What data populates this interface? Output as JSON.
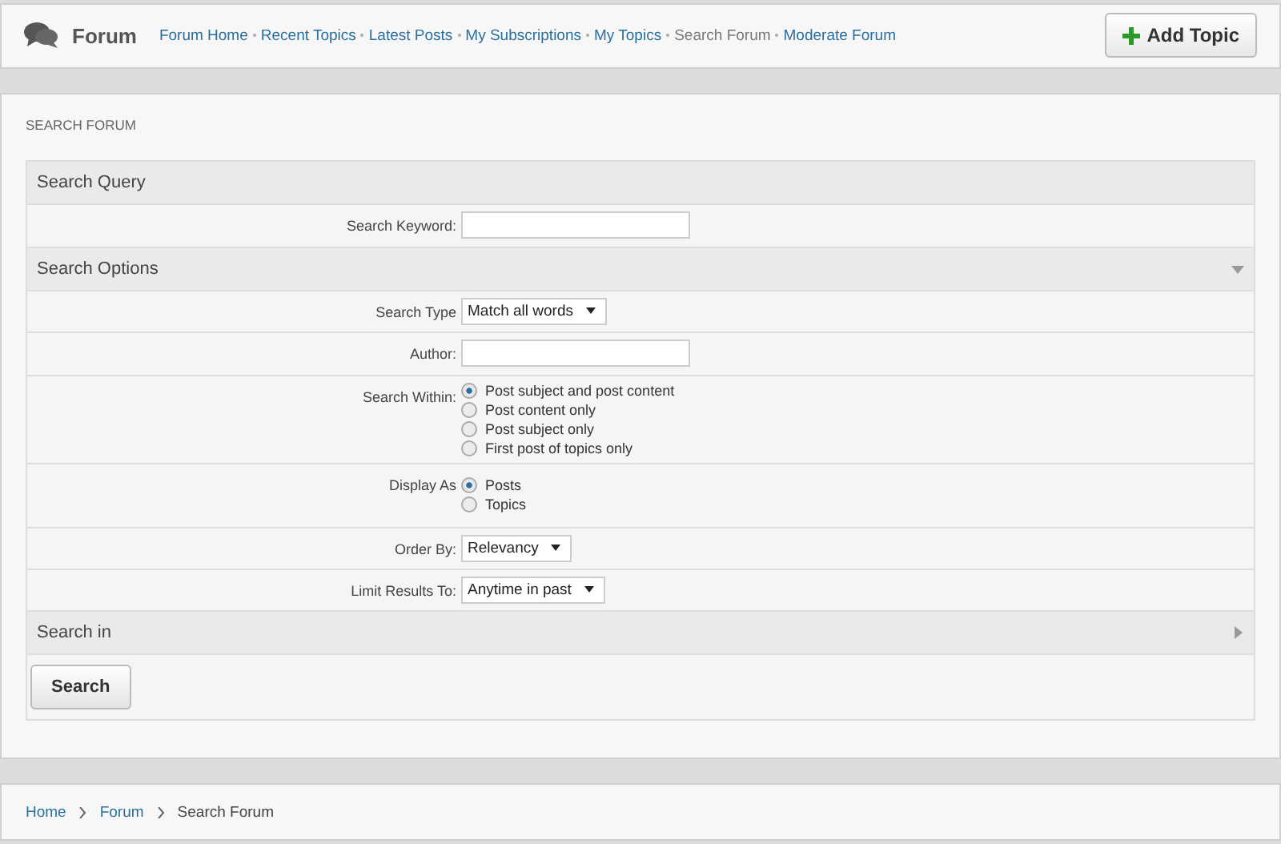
{
  "header": {
    "title": "Forum",
    "nav": [
      {
        "label": "Forum Home",
        "selected": false
      },
      {
        "label": "Recent Topics",
        "selected": false
      },
      {
        "label": "Latest Posts",
        "selected": false
      },
      {
        "label": "My Subscriptions",
        "selected": false
      },
      {
        "label": "My Topics",
        "selected": false
      },
      {
        "label": "Search Forum",
        "selected": true
      },
      {
        "label": "Moderate Forum",
        "selected": false
      }
    ],
    "add_button": "Add Topic"
  },
  "page_title": "SEARCH FORUM",
  "sections": [
    {
      "title": "Search Query",
      "rows": [
        {
          "kind": "text",
          "label": "Search Keyword:"
        }
      ]
    },
    {
      "title": "Search Options",
      "expanded": true,
      "rows": [
        {
          "kind": "select",
          "label": "Search Type",
          "value": "Match all words"
        },
        {
          "kind": "text",
          "label": "Author:"
        },
        {
          "kind": "radio",
          "label": "Search Within:",
          "options": [
            {
              "label": "Post subject and post content",
              "selected": true
            },
            {
              "label": "Post content only",
              "selected": false
            },
            {
              "label": "Post subject only",
              "selected": false
            },
            {
              "label": "First post of topics only",
              "selected": false
            }
          ]
        },
        {
          "kind": "radio",
          "label": "Display As",
          "options": [
            {
              "label": "Posts",
              "selected": true
            },
            {
              "label": "Topics",
              "selected": false
            }
          ]
        },
        {
          "kind": "select",
          "label": "Order By:",
          "value": "Relevancy"
        },
        {
          "kind": "select",
          "label": "Limit Results To:",
          "value": "Anytime in past"
        }
      ]
    },
    {
      "title": "Search in",
      "expanded": false
    }
  ],
  "search_button": "Search",
  "breadcrumbs": [
    "Home",
    "Forum",
    "Search Forum"
  ]
}
